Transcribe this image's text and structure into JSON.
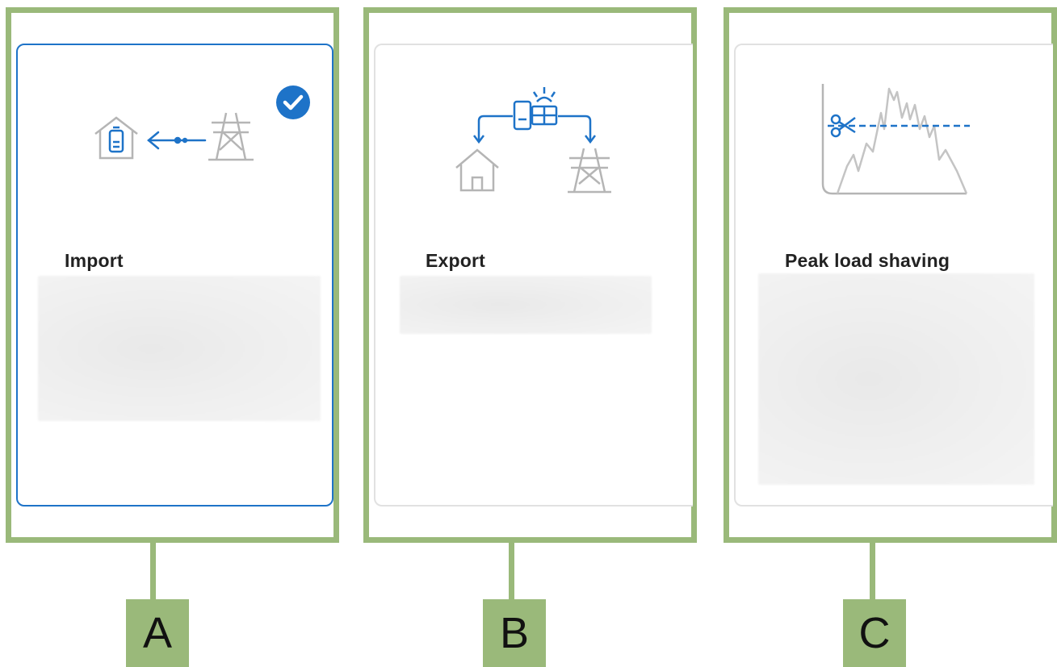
{
  "cards": [
    {
      "id": "A",
      "title": "Import",
      "selected": true
    },
    {
      "id": "B",
      "title": "Export",
      "selected": false
    },
    {
      "id": "C",
      "title": "Peak load shaving",
      "selected": false
    }
  ],
  "colors": {
    "accent": "#1e73c8",
    "frame": "#9ab97a",
    "icon_gray": "#b5b5b5"
  },
  "icons": [
    "house-battery-icon",
    "arrow-left-icon",
    "power-tower-icon",
    "battery-solar-icon",
    "house-icon",
    "scissors-icon",
    "load-curve-icon",
    "checkmark-icon"
  ]
}
